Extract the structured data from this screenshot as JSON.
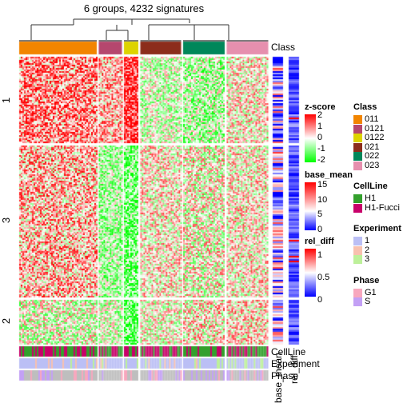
{
  "chart_data": {
    "type": "heatmap",
    "title": "6 groups, 4232 signatures",
    "column_groups": [
      {
        "label": "011",
        "color": "#F28500",
        "width": 97
      },
      {
        "label": "0121",
        "color": "#B5476E",
        "width": 29
      },
      {
        "label": "0122",
        "color": "#DDD300",
        "width": 18
      },
      {
        "label": "021",
        "color": "#8C2D1B",
        "width": 51
      },
      {
        "label": "022",
        "color": "#00875A",
        "width": 52
      },
      {
        "label": "023",
        "color": "#E68FAE",
        "width": 52
      }
    ],
    "row_groups": [
      "1",
      "3",
      "2"
    ],
    "column_annotations": [
      "Class",
      "CellLine",
      "Experiment",
      "Phase"
    ],
    "row_annotations": [
      "base_mean",
      "rel_diff"
    ],
    "legends": {
      "zscore": {
        "title": "z-score",
        "ticks": [
          "2",
          "1",
          "0",
          "-1",
          "-2"
        ],
        "colors": [
          "#FF0000",
          "#FFFFFF",
          "#00FF00"
        ]
      },
      "base_mean": {
        "title": "base_mean",
        "ticks": [
          "15",
          "10",
          "5",
          "0"
        ],
        "colors": [
          "#FF0000",
          "#FFFFFF",
          "#0000FF"
        ]
      },
      "rel_diff": {
        "title": "rel_diff",
        "ticks": [
          "1",
          "0.5",
          "0"
        ],
        "colors": [
          "#FF0000",
          "#FFFFFF",
          "#0000FF"
        ]
      },
      "class": {
        "title": "Class",
        "items": [
          {
            "label": "011",
            "color": "#F28500"
          },
          {
            "label": "0121",
            "color": "#B5476E"
          },
          {
            "label": "0122",
            "color": "#DDD300"
          },
          {
            "label": "021",
            "color": "#8C2D1B"
          },
          {
            "label": "022",
            "color": "#00875A"
          },
          {
            "label": "023",
            "color": "#E68FAE"
          }
        ]
      },
      "cellline": {
        "title": "CellLine",
        "items": [
          {
            "label": "H1",
            "color": "#33A02C"
          },
          {
            "label": "H1-Fucci",
            "color": "#C8006A"
          }
        ]
      },
      "experiment": {
        "title": "Experiment",
        "items": [
          {
            "label": "1",
            "color": "#BBBFF5"
          },
          {
            "label": "2",
            "color": "#F8C1AF"
          },
          {
            "label": "3",
            "color": "#BDF09A"
          }
        ]
      },
      "phase": {
        "title": "Phase",
        "items": [
          {
            "label": "G1",
            "color": "#F8A8BE"
          },
          {
            "label": "S",
            "color": "#C3A0F5"
          }
        ]
      }
    }
  }
}
